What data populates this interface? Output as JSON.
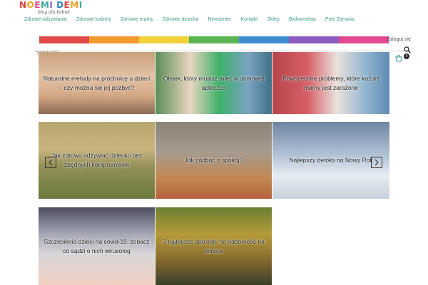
{
  "header": {
    "logo_text": "NOEMI DEMI",
    "logo_letters": [
      {
        "ch": "N",
        "color": "#e0403f"
      },
      {
        "ch": "O",
        "color": "#f0a020"
      },
      {
        "ch": "E",
        "color": "#e84a90"
      },
      {
        "ch": "M",
        "color": "#3fa9a0"
      },
      {
        "ch": "I",
        "color": "#8a5cc0"
      },
      {
        "ch": " ",
        "color": "#000000"
      },
      {
        "ch": "D",
        "color": "#2f86c8"
      },
      {
        "ch": "E",
        "color": "#e0403f"
      },
      {
        "ch": "M",
        "color": "#f0a020"
      },
      {
        "ch": "I",
        "color": "#3fa9a0"
      }
    ],
    "tagline": "blog dla kobiet",
    "login": "Zaloguj się",
    "search_placeholder": "Search here...",
    "cart_count": "0"
  },
  "nav": {
    "items": [
      "Zdrowe odżywianie",
      "Zdrowie kobiety",
      "Zdrowie mamy",
      "Zdrowie dziecka",
      "Newsletter",
      "Kontakt",
      "Sklep",
      "Bioloveshop",
      "Pole Zdrowia"
    ]
  },
  "posts": [
    {
      "title": "Naturalne metody na próchnicę u dzieci – czy można się jej pozbyć?"
    },
    {
      "title": "Olejek, który musisz mieć w domowej apteczce"
    },
    {
      "title": "Powszechne problemy, które każdej mamy jest zarażone"
    },
    {
      "title": "Jak zdrowo odżywiać dziecko bez zbędnych kompromisów"
    },
    {
      "title": "Jak zadbać o spokój?"
    },
    {
      "title": "Najlepszy detoks na Nowy Rok"
    },
    {
      "title": "Szczepienia dzieci na covid-19, zobacz co sądzi o nich wirusolog"
    },
    {
      "title": "3 najlepsze sposoby na odporność na wirusa"
    }
  ],
  "colors": {
    "nav_link": "#3a9a8c",
    "strip": [
      "#e04a4a",
      "#f29a2e",
      "#f2d23a",
      "#5ab552",
      "#3f8ed0",
      "#8a5cc0",
      "#e04a90"
    ]
  },
  "icons": [
    "search-icon",
    "cart-icon",
    "chevron-left-icon",
    "chevron-right-icon"
  ]
}
